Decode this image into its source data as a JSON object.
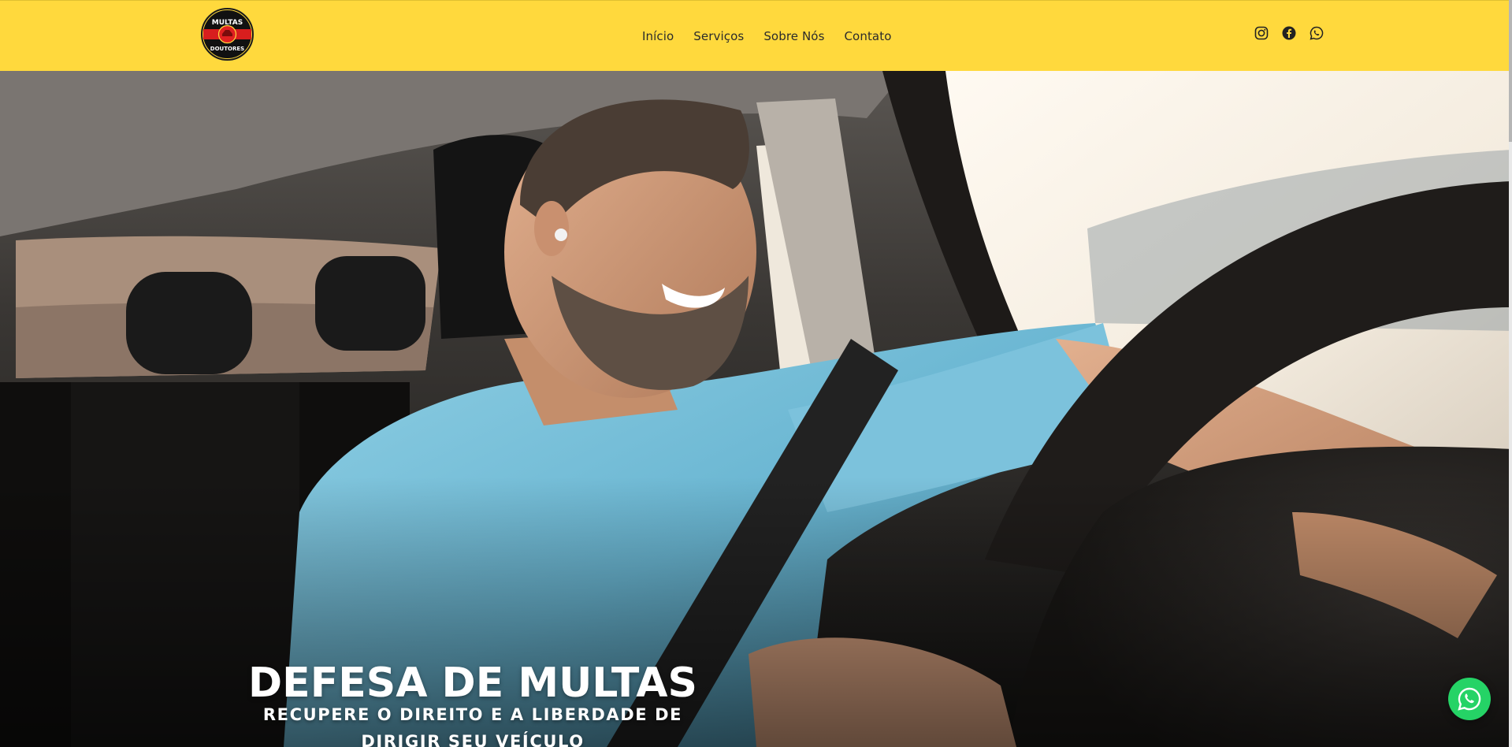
{
  "brand": {
    "logo_top": "MULTAS",
    "logo_bottom": "DOUTORES",
    "primary_color": "#ffd93d",
    "accent_red": "#d81e1e",
    "whatsapp_green": "#25d366"
  },
  "nav": {
    "items": [
      {
        "label": "Início"
      },
      {
        "label": "Serviços"
      },
      {
        "label": "Sobre Nós"
      },
      {
        "label": "Contato"
      }
    ]
  },
  "social": {
    "icons": [
      "instagram-icon",
      "facebook-icon",
      "whatsapp-icon"
    ]
  },
  "hero": {
    "title": "DEFESA DE MULTAS",
    "subtitle_line1": "RECUPERE O DIREITO E A LIBERDADE DE",
    "subtitle_line2": "DIRIGIR SEU VEÍCULO",
    "image": "smiling-driver-photo"
  },
  "floating": {
    "icon": "whatsapp-icon"
  }
}
